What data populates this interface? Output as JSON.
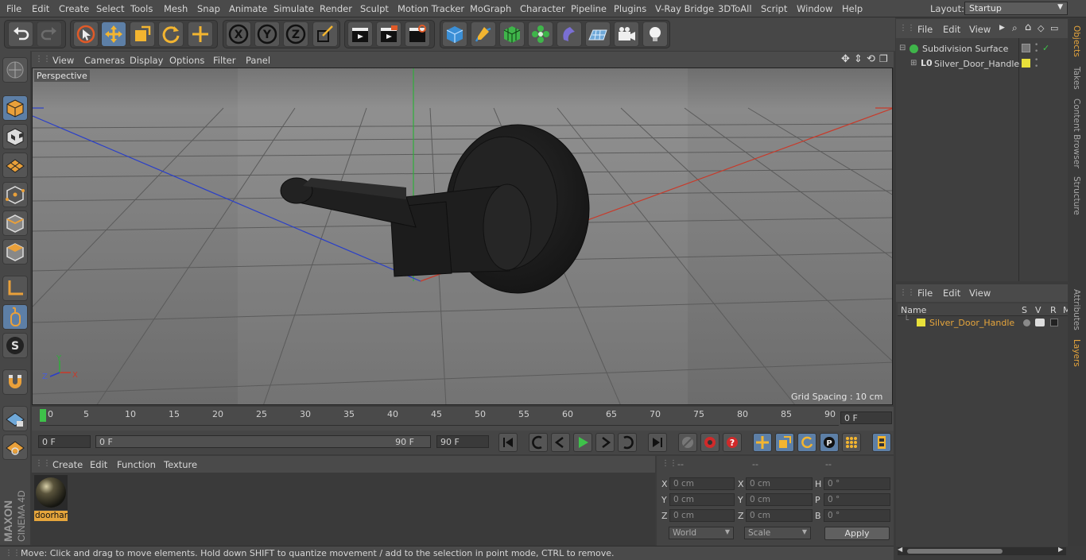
{
  "menubar": {
    "items": [
      "File",
      "Edit",
      "Create",
      "Select",
      "Tools",
      "Mesh",
      "Snap",
      "Animate",
      "Simulate",
      "Render",
      "Sculpt",
      "Motion Tracker",
      "MoGraph",
      "Character",
      "Pipeline",
      "Plugins",
      "V-Ray Bridge",
      "3DToAll",
      "Script",
      "Window",
      "Help"
    ],
    "layout_label": "Layout:",
    "layout_value": "Startup"
  },
  "viewport": {
    "menu": [
      "View",
      "Cameras",
      "Display",
      "Options",
      "Filter",
      "Panel"
    ],
    "camera_label": "Perspective",
    "grid_spacing": "Grid Spacing : 10 cm",
    "axis_labels": {
      "x": "X",
      "y": "Y",
      "z": "Z"
    }
  },
  "timeline": {
    "ticks": [
      "0",
      "5",
      "10",
      "15",
      "20",
      "25",
      "30",
      "35",
      "40",
      "45",
      "50",
      "55",
      "60",
      "65",
      "70",
      "75",
      "80",
      "85",
      "90"
    ],
    "current_frame": "0 F",
    "start_field": "0 F",
    "range_start": "0 F",
    "range_end": "90 F",
    "end_field": "90 F"
  },
  "material_manager": {
    "menu": [
      "Create",
      "Edit",
      "Function",
      "Texture"
    ],
    "materials": [
      {
        "name": "doorhar"
      }
    ]
  },
  "coordinates": {
    "headers": [
      "--",
      "--",
      "--"
    ],
    "rows": [
      {
        "l1": "X",
        "v1": "0 cm",
        "l2": "X",
        "v2": "0 cm",
        "l3": "H",
        "v3": "0 °"
      },
      {
        "l1": "Y",
        "v1": "0 cm",
        "l2": "Y",
        "v2": "0 cm",
        "l3": "P",
        "v3": "0 °"
      },
      {
        "l1": "Z",
        "v1": "0 cm",
        "l2": "Z",
        "v2": "0 cm",
        "l3": "B",
        "v3": "0 °"
      }
    ],
    "world_dropdown": "World",
    "scale_dropdown": "Scale",
    "apply_label": "Apply"
  },
  "status": "Move: Click and drag to move elements. Hold down SHIFT to quantize movement / add to the selection in point mode, CTRL to remove.",
  "objects_panel": {
    "menu": [
      "File",
      "Edit",
      "View"
    ],
    "items": [
      {
        "name": "Subdivision Surface"
      },
      {
        "name": "Silver_Door_Handle"
      }
    ]
  },
  "layers_panel": {
    "menu": [
      "File",
      "Edit",
      "View"
    ],
    "columns": [
      "Name",
      "S",
      "V",
      "R",
      "M"
    ],
    "items": [
      {
        "name": "Silver_Door_Handle",
        "color": "#e8e03a"
      }
    ]
  },
  "side_tabs": [
    "Objects",
    "Takes",
    "Content Browser",
    "Structure",
    "Attributes",
    "Layers"
  ],
  "brand": {
    "line1": "MAXON",
    "line2": "CINEMA 4D"
  },
  "colors": {
    "accent": "#e6a53c",
    "selected": "#5d7fa6",
    "layer_yellow": "#e8e03a",
    "object_name": "#e6a53c"
  }
}
